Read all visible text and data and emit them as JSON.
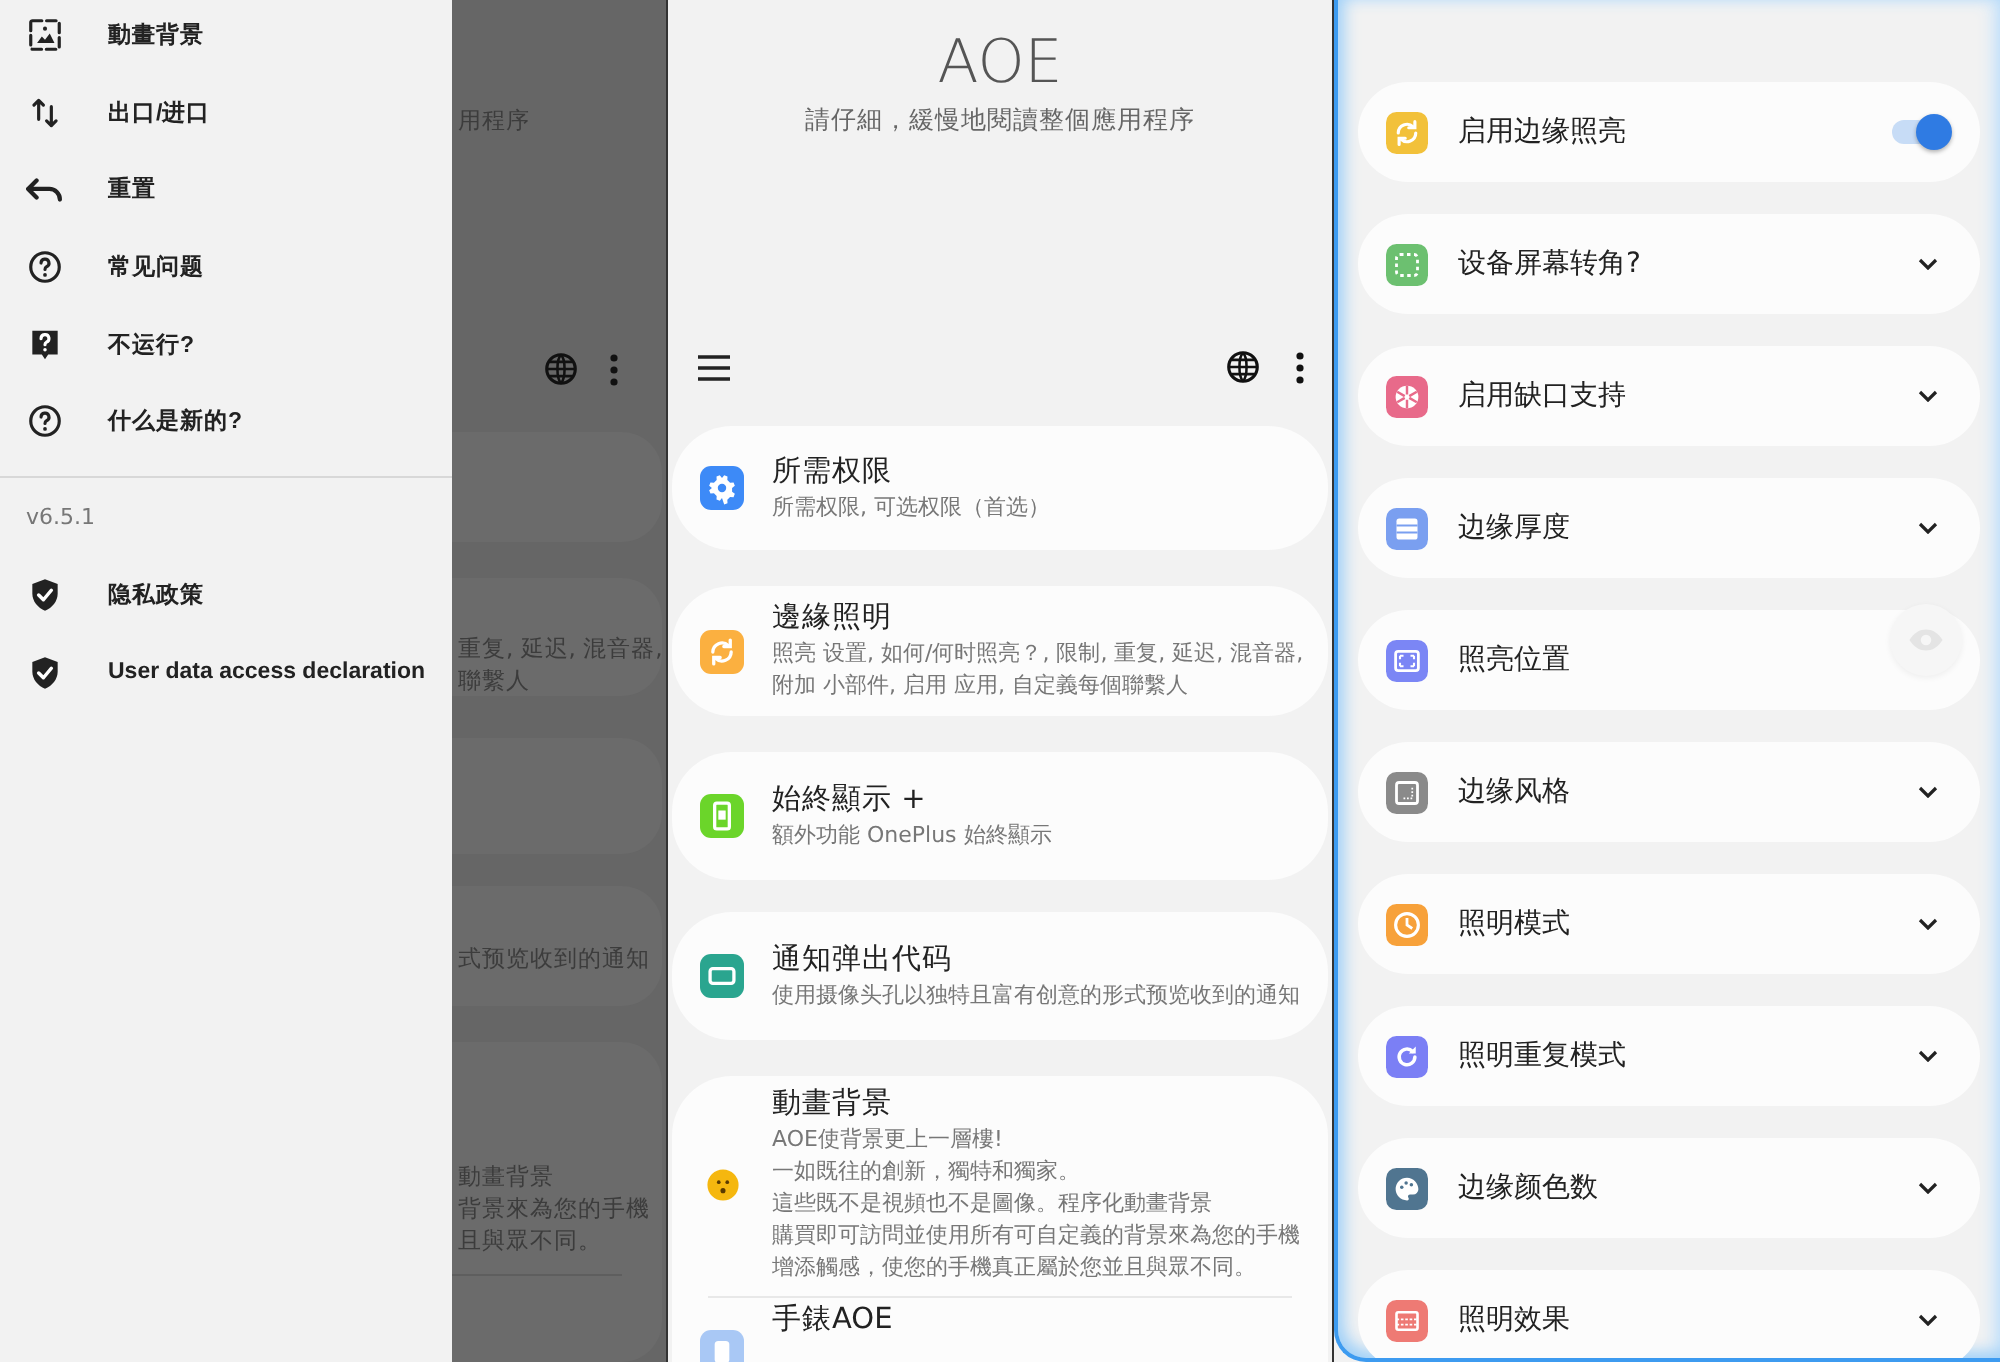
{
  "drawer": {
    "items": [
      {
        "label": "動畫背景"
      },
      {
        "label": "出口/进口"
      },
      {
        "label": "重置"
      },
      {
        "label": "常见问题"
      },
      {
        "label": "不运行?"
      },
      {
        "label": "什么是新的?"
      }
    ],
    "version": "v6.5.1",
    "footer_items": [
      {
        "label": "隐私政策"
      },
      {
        "label": "User data access declaration"
      }
    ]
  },
  "backdrop": {
    "texts": [
      "用程序",
      "重复, 延迟, 混音器,",
      "聯繫人",
      "式预览收到的通知",
      "動畫背景",
      "背景來為您的手機",
      "且與眾不同。"
    ]
  },
  "main": {
    "title": "AOE",
    "subtitle": "請仔細，緩慢地閱讀整個應用程序",
    "cards": [
      {
        "title": "所需权限",
        "description": "所需权限, 可选权限（首选）",
        "color": "#3d8af7"
      },
      {
        "title": "邊緣照明",
        "description": "照亮 设置, 如何/何时照亮？, 限制, 重复, 延迟, 混音器, 附加 小部件, 启用 应用, 自定義每個聯繫人",
        "color": "#fbb040"
      },
      {
        "title": "始終顯示 +",
        "description": "額外功能 OnePlus 始終顯示",
        "color": "#6bd52a"
      },
      {
        "title": "通知弹出代码",
        "description": "使用摄像头孔以独特且富有创意的形式预览收到的通知",
        "color": "#2aa58f"
      }
    ],
    "feature": {
      "title": "動畫背景",
      "lines": [
        "AOE使背景更上一層樓!",
        "一如既往的創新，獨特和獨家。",
        "這些既不是視頻也不是圖像。程序化動畫背景",
        "購買即可訪問並使用所有可自定義的背景來為您的手機",
        "增添觸感，使您的手機真正屬於您並且與眾不同。"
      ]
    },
    "next": {
      "title": "手錶AOE"
    }
  },
  "settings": {
    "rows": [
      {
        "label": "启用边缘照亮",
        "kind": "toggle",
        "on": true,
        "color": "#f2c13a"
      },
      {
        "label": "设备屏幕转角?",
        "kind": "expand",
        "expanded": false,
        "color": "#6cc070"
      },
      {
        "label": "启用缺口支持",
        "kind": "expand",
        "expanded": false,
        "color": "#e86a8a"
      },
      {
        "label": "边缘厚度",
        "kind": "expand",
        "expanded": false,
        "color": "#7a9ff0"
      },
      {
        "label": "照亮位置",
        "kind": "plain",
        "color": "#7b86f5"
      },
      {
        "label": "边缘风格",
        "kind": "expand",
        "expanded": false,
        "color": "#8a8a8a"
      },
      {
        "label": "照明模式",
        "kind": "expand",
        "expanded": false,
        "color": "#f7a13a"
      },
      {
        "label": "照明重复模式",
        "kind": "expand",
        "expanded": false,
        "color": "#7b7ff5"
      },
      {
        "label": "边缘颜色数",
        "kind": "expand",
        "expanded": false,
        "color": "#507590"
      },
      {
        "label": "照明效果",
        "kind": "expand",
        "expanded": false,
        "color": "#ee7a74"
      }
    ]
  }
}
